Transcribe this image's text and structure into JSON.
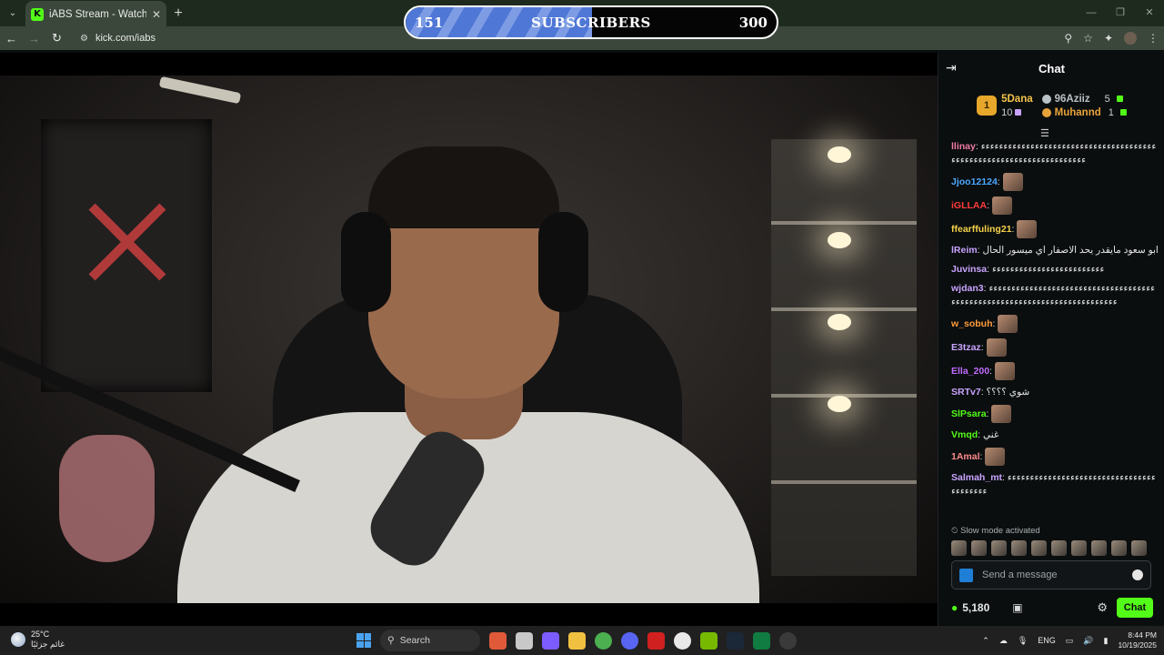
{
  "browser": {
    "tab_title": "iABS Stream - Watch Live on Kick",
    "url": "kick.com/iabs"
  },
  "subscriber_goal": {
    "current": "151",
    "label": "SUBSCRIBERS",
    "target": "300",
    "progress": 0.503
  },
  "chat": {
    "title": "Chat",
    "leaderboard": {
      "first": {
        "rank": "1",
        "name": "5Dana",
        "count": "10",
        "color": "#f3c34b"
      },
      "second": {
        "name": "96Aziiz",
        "count": "5",
        "color": "#b9c2c6"
      },
      "third": {
        "name": "Muhannd",
        "count": "1",
        "color": "#e8a23a"
      }
    },
    "messages": [
      {
        "user": "llinay",
        "text": "ءءءءءءءءءءءءءءءءءءءءءءءءءءءءءءءءءءءءءءءءءءءءءءءءءءءءءءءءءءءءءءءءءءءءء",
        "color": "#f07aa6"
      },
      {
        "user": "Jjoo12124",
        "text": "",
        "color": "#4aa8ff"
      },
      {
        "user": "iGLLAA",
        "text": "",
        "color": "#ff3b3b"
      },
      {
        "user": "ffearffuling21",
        "text": "",
        "color": "#f5d24a"
      },
      {
        "user": "lReim",
        "text": "ابو سعود مايقدر يحد الاصفار اي ميسور الحال",
        "color": "#c9a4ff"
      },
      {
        "user": "Juvinsa",
        "text": "ءءءءءءءءءءءءءءءءءءءءءءءءء",
        "color": "#c9a4ff"
      },
      {
        "user": "wjdan3",
        "text": "ءءءءءءءءءءءءءءءءءءءءءءءءءءءءءءءءءءءءءءءءءءءءءءءءءءءءءءءءءءءءءءءءءءءءءءءءءء",
        "color": "#c9a4ff"
      },
      {
        "user": "w_sobuh",
        "text": "",
        "color": "#ff9c3b"
      },
      {
        "user": "E3tzaz",
        "text": "",
        "color": "#c9a4ff"
      },
      {
        "user": "Ella_200",
        "text": "",
        "color": "#c06bff"
      },
      {
        "user": "SRTv7",
        "text": "شوي ؟؟؟؟",
        "color": "#c9a4ff"
      },
      {
        "user": "SlPsara",
        "text": "",
        "color": "#53fc18"
      },
      {
        "user": "Vmqd",
        "text": "غني",
        "color": "#53fc18"
      },
      {
        "user": "1Amal",
        "text": "",
        "color": "#ff8a8a"
      },
      {
        "user": "Salmah_mt",
        "text": "ءءءءءءءءءءءءءءءءءءءءءءءءءءءءءءءءءءءءءءءءء",
        "color": "#c9a4ff"
      }
    ],
    "slow_mode": "Slow mode activated",
    "input_placeholder": "Send a message",
    "points": "5,180",
    "send_label": "Chat"
  },
  "taskbar": {
    "temperature": "25°C",
    "weather_desc": "غائم جزئيًا",
    "search_label": "Search",
    "language": "ENG",
    "time": "8:44 PM",
    "date": "10/19/2025"
  }
}
